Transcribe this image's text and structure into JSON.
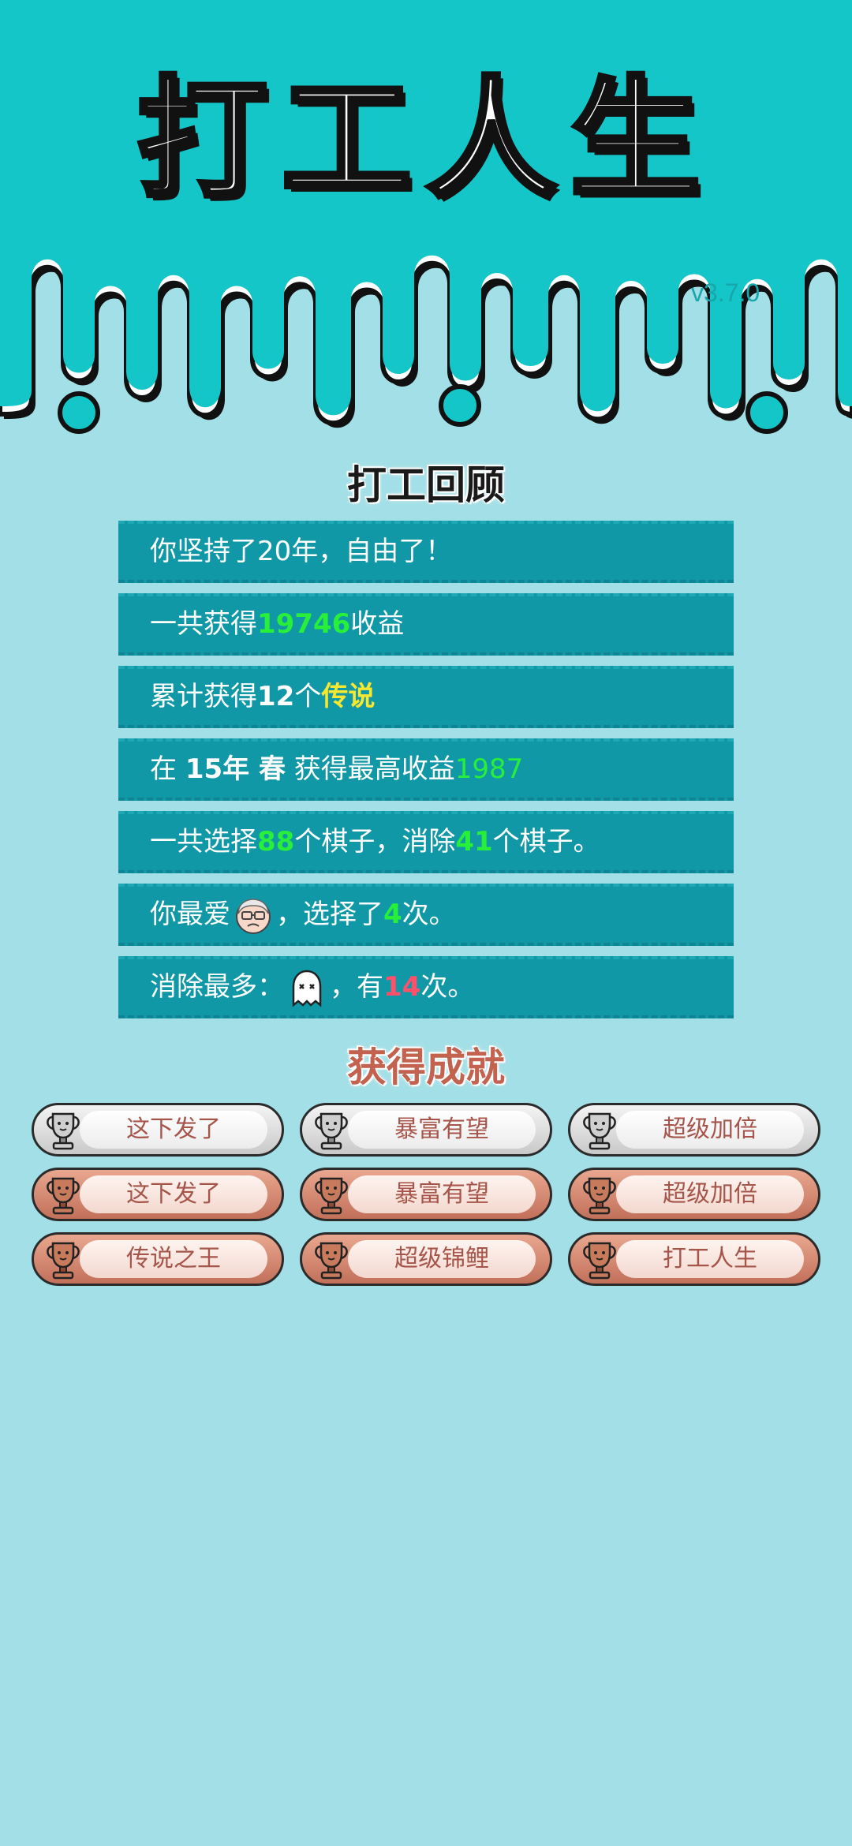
{
  "header": {
    "title": "打工人生",
    "version": "v3.7.0"
  },
  "review": {
    "title": "打工回顾",
    "rows": [
      {
        "a": "你坚持了20年，自由了！"
      },
      {
        "a": "一共获得",
        "n": "19746",
        "b": "收益"
      },
      {
        "a": "累计获得",
        "n": "12",
        "b": "个",
        "c": "传说"
      },
      {
        "a": "在 ",
        "n1": "15年 春",
        "b": " 获得最高收益",
        "n2": "1987"
      },
      {
        "a": "一共选择",
        "n1": "88",
        "b": "个棋子，消除",
        "n2": "41",
        "c": "个棋子。"
      },
      {
        "a": "你最爱",
        "icon": "grandpa-face-icon",
        "b": "，选择了",
        "n": "4",
        "c": "次。"
      },
      {
        "a": "消除最多：",
        "icon": "ghost-icon",
        "b": "，有",
        "n": "14",
        "c": "次。"
      }
    ]
  },
  "achievements": {
    "title": "获得成就",
    "items": [
      {
        "label": "这下发了",
        "tier": "silver"
      },
      {
        "label": "暴富有望",
        "tier": "silver"
      },
      {
        "label": "超级加倍",
        "tier": "silver"
      },
      {
        "label": "这下发了",
        "tier": "bronze"
      },
      {
        "label": "暴富有望",
        "tier": "bronze"
      },
      {
        "label": "超级加倍",
        "tier": "bronze"
      },
      {
        "label": "传说之王",
        "tier": "bronze"
      },
      {
        "label": "超级锦鲤",
        "tier": "bronze"
      },
      {
        "label": "打工人生",
        "tier": "bronze"
      }
    ]
  },
  "colors": {
    "header_bg": "#14c6c8",
    "page_bg": "#a3dfe6",
    "row_bg": "#1198a6",
    "highlight_green": "#27ef3a",
    "highlight_red": "#ff4f6a",
    "highlight_yellow": "#f6e731"
  }
}
